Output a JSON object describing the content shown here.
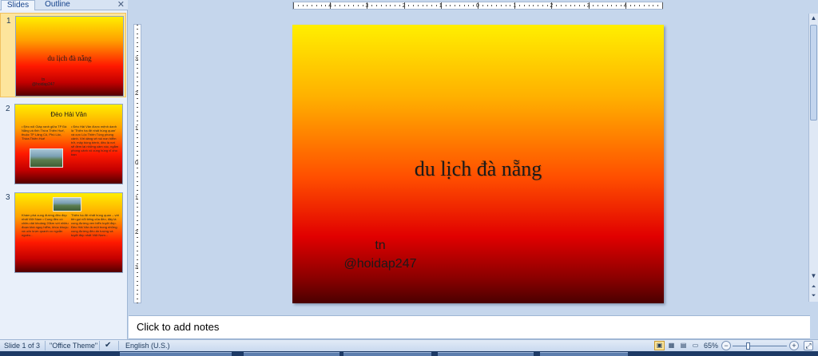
{
  "left_pane": {
    "tabs": [
      "Slides",
      "Outline"
    ],
    "close_glyph": "✕"
  },
  "thumbnails": [
    {
      "number": "1",
      "title": "du lịch đà nẵng",
      "subtitle_lines": [
        "tn",
        "@hoidap247"
      ]
    },
    {
      "number": "2",
      "title": "Đèo Hải Vân",
      "left_text": "• Đèo nối Giáp ranh giữa TP Đà Nẵng và tỉnh Thừa Thiên Huế, thuộc TP Lăng Cô, Phú Lộc, Thừa Thiên Huế",
      "right_text": "• Đèo Hải Vân được mệnh danh là 'Thiên hạ đệ nhất hùng quan' và cực Lộc Thiên Tùng phong cảnh. Với dáng vẻ núi non hiểm trở, mây bồng bềnh, đèo là nơi sẽ đem lại những cảm xúc, ngắm phong cảnh vô cùng hùng vĩ cho bạn"
    },
    {
      "number": "3",
      "left_text": "Khám phá cung đường đèo đẹp nhất Việt Nam • Cung đèo có chiều dài khoảng 20km với nhiều đoạn khá nguy hiểm, khúc khuỷu và uốn lượn quanh co ngoằn ngoèo...",
      "right_text": "Thiên hạ đệ nhất hùng quan – với tên gọi nổi tiếng của đèo, đây là cung đường ven biển tuyệt đẹp. Đèo Hải Vân là một trong những cung đường đèo ấn tượng và tuyệt đẹp nhất Việt Nam..."
    }
  ],
  "slide": {
    "title": "du lịch đà nẵng",
    "subtitle_lines": [
      "tn",
      "@hoidap247"
    ]
  },
  "rulers": {
    "horizontal": [
      "4",
      "3",
      "2",
      "1",
      "0",
      "1",
      "2",
      "3",
      "4"
    ],
    "vertical": [
      "3",
      "2",
      "1",
      "0",
      "1",
      "2",
      "3"
    ]
  },
  "notes": {
    "placeholder": "Click to add notes"
  },
  "status_bar": {
    "slide_info": "Slide 1 of 3",
    "theme": "\"Office Theme\"",
    "language": "English (U.S.)",
    "zoom": "65%"
  },
  "colors": {
    "slide_top": "#ffef00",
    "slide_bottom": "#4a0000",
    "selected_thumb": "#fde59c",
    "chrome_bg": "#c5d6ec"
  }
}
